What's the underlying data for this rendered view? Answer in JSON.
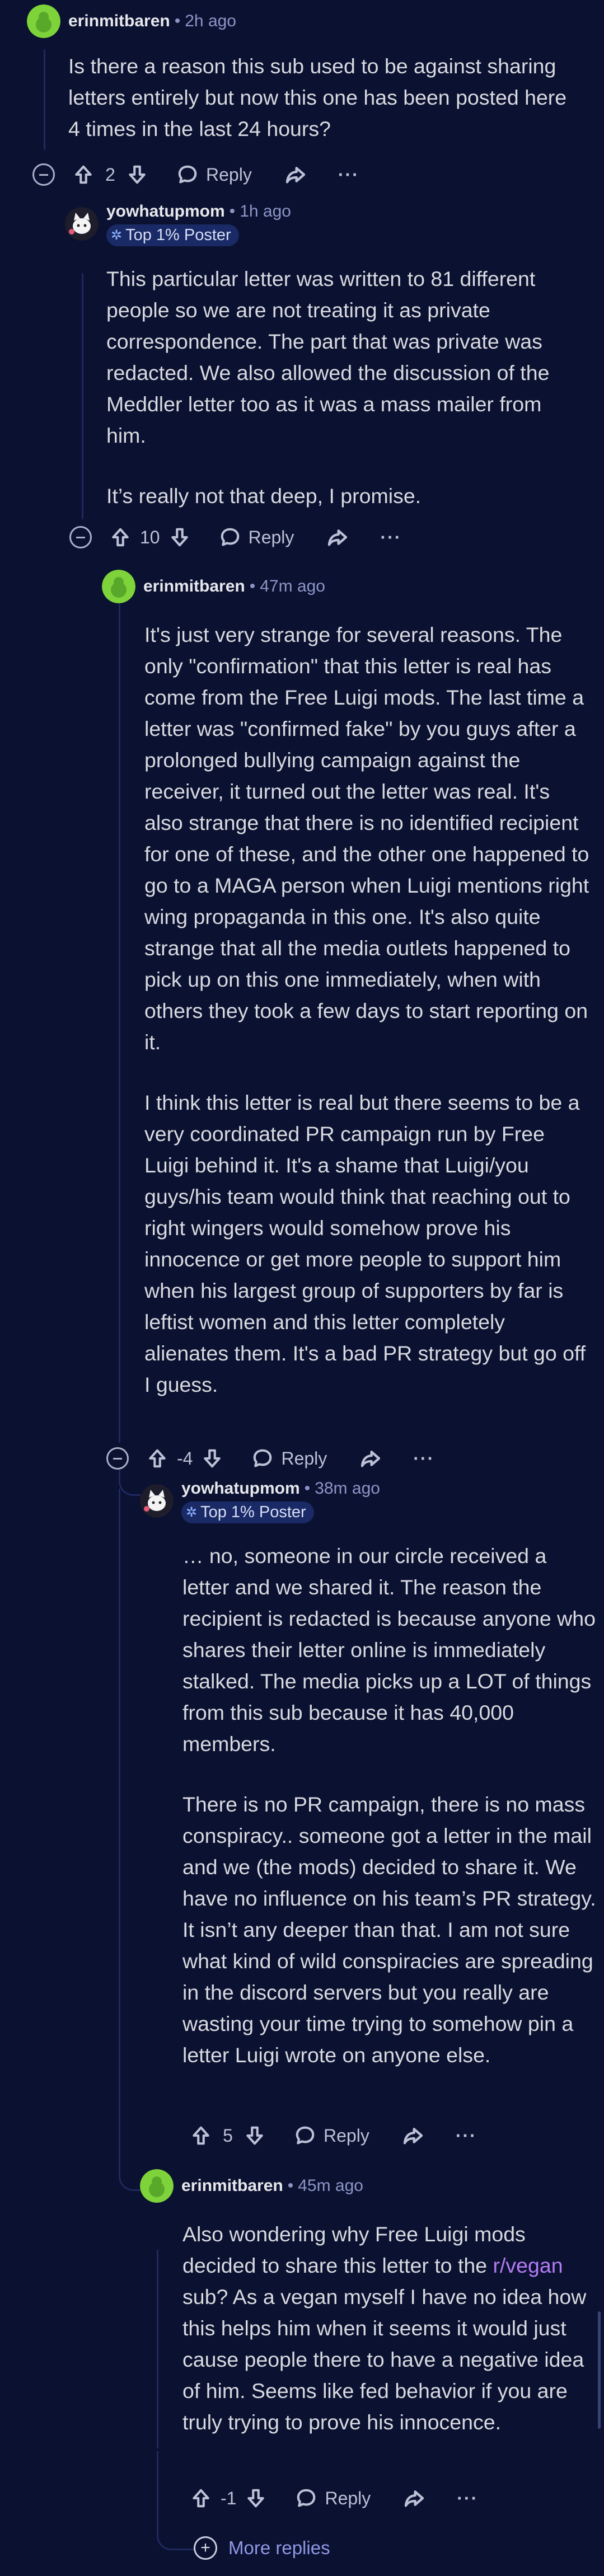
{
  "comments": [
    {
      "user": "erinmitbaren",
      "time": "2h ago",
      "flair": "",
      "paragraphs": [
        "Is there a reason this sub used to be against sharing letters entirely but now this one has been posted here 4 times in the last 24 hours?"
      ],
      "score": "2"
    },
    {
      "user": "yowhatupmom",
      "time": "1h ago",
      "flair": "Top 1% Poster",
      "paragraphs": [
        "This particular letter was written to 81 different people so we are not treating it as private correspondence. The part that was private was redacted. We also allowed the discussion of the Meddler letter too as it was a mass mailer from him.",
        "It’s really not that deep, I promise."
      ],
      "score": "10"
    },
    {
      "user": "erinmitbaren",
      "time": "47m ago",
      "flair": "",
      "paragraphs": [
        "It's just very strange for several reasons. The only \"confirmation\" that this letter is real has come from the Free Luigi mods. The last time a letter was \"confirmed fake\" by you guys after a prolonged bullying campaign against the receiver, it turned out the letter was real. It's also strange that there is no identified recipient for one of these, and the other one happened to go to a MAGA person when Luigi mentions right wing propaganda in this one. It's also quite strange that all the media outlets happened to pick up on this one immediately, when with others they took a few days to start reporting on it.",
        "I think this letter is real but there seems to be a very coordinated PR campaign run by Free Luigi behind it. It's a shame that Luigi/you guys/his team would think that reaching out to right wingers would somehow prove his innocence or get more people to support him when his largest group of supporters by far is leftist women and this letter completely alienates them. It's a bad PR strategy but go off I guess."
      ],
      "score": "-4"
    },
    {
      "user": "yowhatupmom",
      "time": "38m ago",
      "flair": "Top 1% Poster",
      "paragraphs": [
        "… no, someone in our circle received a letter and we shared it. The reason the recipient is redacted is because anyone who shares their letter online is immediately stalked. The media picks up a LOT of things from this sub because it has 40,000 members.",
        "There is no PR campaign, there is no mass conspiracy.. someone got a letter in the mail and we (the mods) decided to share it. We have no influence on his team’s PR strategy. It isn’t any deeper than that. I am not sure what kind of wild conspiracies are spreading in the discord servers but you really are wasting your time trying to somehow pin a letter Luigi wrote on anyone else."
      ],
      "score": "5"
    },
    {
      "user": "erinmitbaren",
      "time": "45m ago",
      "flair": "",
      "paragraphs_pre": "Also wondering why Free Luigi mods decided to share this letter to the",
      "subreddit": "r/vegan",
      "paragraphs_post": "sub? As a vegan myself I have no idea how this helps him when it seems it would just cause people there to have a negative idea of him. Seems like fed behavior if you are truly trying to prove his innocence.",
      "score": "-1"
    }
  ],
  "labels": {
    "reply": "Reply",
    "more": "···",
    "more_replies": "More replies"
  },
  "colors": {
    "background": "#0b1130",
    "thread_line": "#1e2960",
    "username_time": "#8d95c8",
    "flair_bg": "#1a2a66",
    "subreddit_link": "#b37cf5",
    "more_replies": "#8f98e6"
  },
  "icons": [
    "snoo-avatar-icon",
    "cat-avatar-icon",
    "upvote-icon",
    "downvote-icon",
    "reply-bubble-icon",
    "share-arrow-icon",
    "more-options-icon",
    "collapse-icon",
    "expand-plus-icon",
    "sparkle-icon"
  ]
}
